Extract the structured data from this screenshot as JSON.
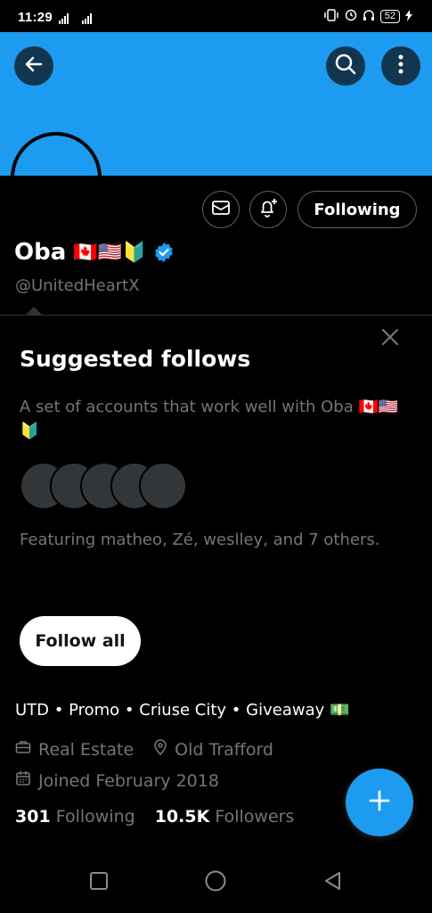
{
  "status_bar": {
    "time": "11:29",
    "signal": "⸪.ıl ᴴ⁴ᴳ.ıl",
    "battery": "52"
  },
  "header": {
    "back_icon": "arrow-left-icon",
    "search_icon": "search-icon",
    "more_icon": "more-vertical-icon",
    "banner_color": "#1d9bf0"
  },
  "profile": {
    "name": "Oba",
    "flags": "🇨🇦🇺🇸🔰",
    "handle": "@UnitedHeartX",
    "verified_color": "#1d9bf0",
    "following_label": "Following",
    "bio": "UTD • Promo • Criuse City • Giveaway 💵",
    "profession": "Real Estate",
    "location": "Old Trafford",
    "joined": "Joined February 2018",
    "following_count": "301",
    "following_label_stat": "Following",
    "followers_count": "10.5K",
    "followers_label": "Followers"
  },
  "suggested": {
    "title": "Suggested follows",
    "description_line1": "A set of accounts that work well with Oba 🇨🇦🇺🇸",
    "description_line2": "🔰",
    "featuring": "Featuring matheo, Zé, weslley, and 7 others.",
    "follow_all_label": "Follow all"
  },
  "accent_color": "#1d9bf0"
}
